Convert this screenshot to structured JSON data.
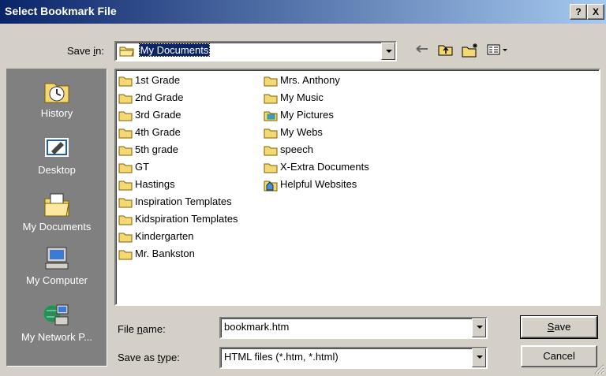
{
  "dialog": {
    "title": "Select Bookmark File",
    "help_label": "?",
    "close_label": "X"
  },
  "save_in": {
    "label_pre": "Save ",
    "label_accel": "i",
    "label_post": "n:",
    "value": "My Documents"
  },
  "toolbar": {
    "back_icon": "back-arrow-icon",
    "up_icon": "up-folder-icon",
    "new_folder_icon": "new-folder-icon",
    "views_icon": "views-menu-icon"
  },
  "places": [
    {
      "label": "History",
      "icon": "history-icon"
    },
    {
      "label": "Desktop",
      "icon": "desktop-icon"
    },
    {
      "label": "My Documents",
      "icon": "my-documents-icon"
    },
    {
      "label": "My Computer",
      "icon": "my-computer-icon"
    },
    {
      "label": "My Network P...",
      "icon": "network-places-icon"
    }
  ],
  "files": {
    "col1": [
      {
        "name": "1st Grade",
        "type": "folder"
      },
      {
        "name": "2nd Grade",
        "type": "folder"
      },
      {
        "name": "3rd Grade",
        "type": "folder"
      },
      {
        "name": "4th Grade",
        "type": "folder"
      },
      {
        "name": "5th grade",
        "type": "folder"
      },
      {
        "name": "GT",
        "type": "folder"
      },
      {
        "name": "Hastings",
        "type": "folder"
      },
      {
        "name": "Inspiration Templates",
        "type": "folder"
      },
      {
        "name": "Kidspiration Templates",
        "type": "folder"
      },
      {
        "name": "Kindergarten",
        "type": "folder"
      },
      {
        "name": "Mr. Bankston",
        "type": "folder"
      }
    ],
    "col2": [
      {
        "name": "Mrs. Anthony",
        "type": "folder"
      },
      {
        "name": "My Music",
        "type": "folder"
      },
      {
        "name": "My Pictures",
        "type": "pictures-folder"
      },
      {
        "name": "My Webs",
        "type": "folder"
      },
      {
        "name": "speech",
        "type": "folder"
      },
      {
        "name": "X-Extra Documents",
        "type": "folder"
      },
      {
        "name": "Helpful Websites",
        "type": "favorites-folder"
      }
    ]
  },
  "file_name": {
    "label_pre": "File ",
    "label_accel": "n",
    "label_post": "ame:",
    "value": "bookmark.htm"
  },
  "save_as_type": {
    "label_pre": "Save as ",
    "label_accel": "t",
    "label_post": "ype:",
    "value": "HTML files (*.htm, *.html)"
  },
  "buttons": {
    "save_accel": "S",
    "save_rest": "ave",
    "cancel": "Cancel"
  },
  "colors": {
    "title_start": "#0a246a",
    "title_end": "#a6caf0",
    "face": "#d4d0c8",
    "places_bg": "#808080",
    "folder": "#f4d874"
  }
}
